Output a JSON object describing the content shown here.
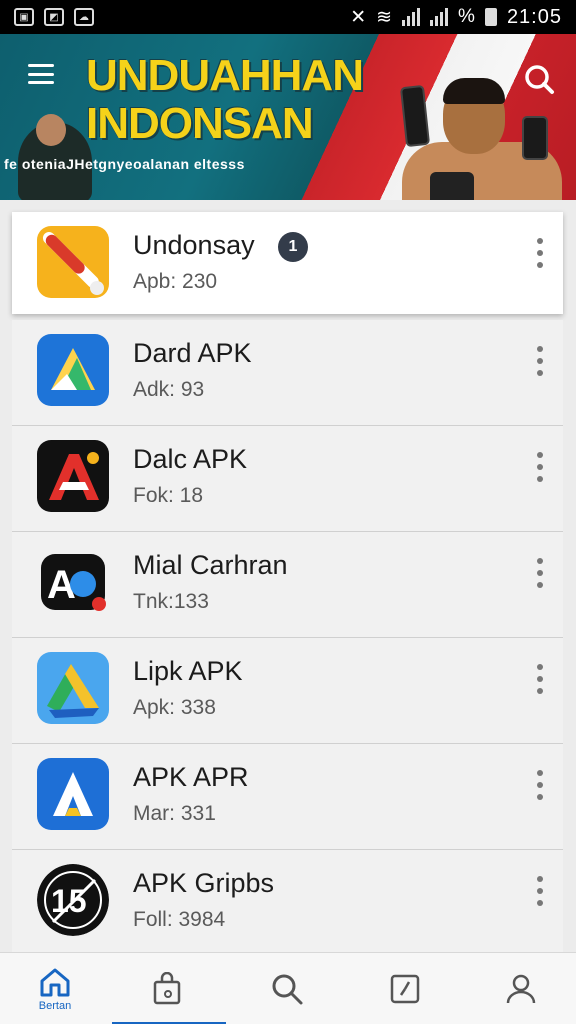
{
  "status_bar": {
    "battery_percent": "%",
    "time": "21:05",
    "icons": [
      "gallery-icon",
      "image-icon",
      "cloud-icon",
      "mute-icon",
      "wifi-icon",
      "signal-icon",
      "battery-icon"
    ]
  },
  "banner": {
    "title_line1": "UNDUAHHAN",
    "title_line2": "INDONSAN",
    "subtitle": "fe oteniaJHetgnyeoalanan eltesss",
    "menu_icon": "menu-icon",
    "search_icon": "search-icon",
    "colors": {
      "teal": "#0e5f6e",
      "red": "#d92a2f",
      "yellow": "#f5d21a"
    }
  },
  "apps": [
    {
      "title": "Undonsay",
      "subtitle": "Apb: 230",
      "badge": "1",
      "icon": "app-icon-orange-slash"
    },
    {
      "title": "Dard APK",
      "subtitle": "Adk: 93",
      "icon": "app-icon-blue-triangle"
    },
    {
      "title": "Dalc APK",
      "subtitle": "Fok: 18",
      "icon": "app-icon-black-a"
    },
    {
      "title": "Mial Carhran",
      "subtitle": "Tnk:133",
      "icon": "app-icon-ap"
    },
    {
      "title": "Lipk APK",
      "subtitle": "Apk: 338",
      "icon": "app-icon-drive-triangle"
    },
    {
      "title": "APK APR",
      "subtitle": "Mar: 331",
      "icon": "app-icon-blue-a"
    },
    {
      "title": "APK Gripbs",
      "subtitle": "Foll: 3984",
      "icon": "app-icon-badge-15"
    }
  ],
  "bottom_nav": {
    "home_label": "Bertan",
    "items": [
      "home-icon",
      "bag-icon",
      "search-icon",
      "clock-icon",
      "profile-icon"
    ],
    "accent": "#1766c2"
  }
}
